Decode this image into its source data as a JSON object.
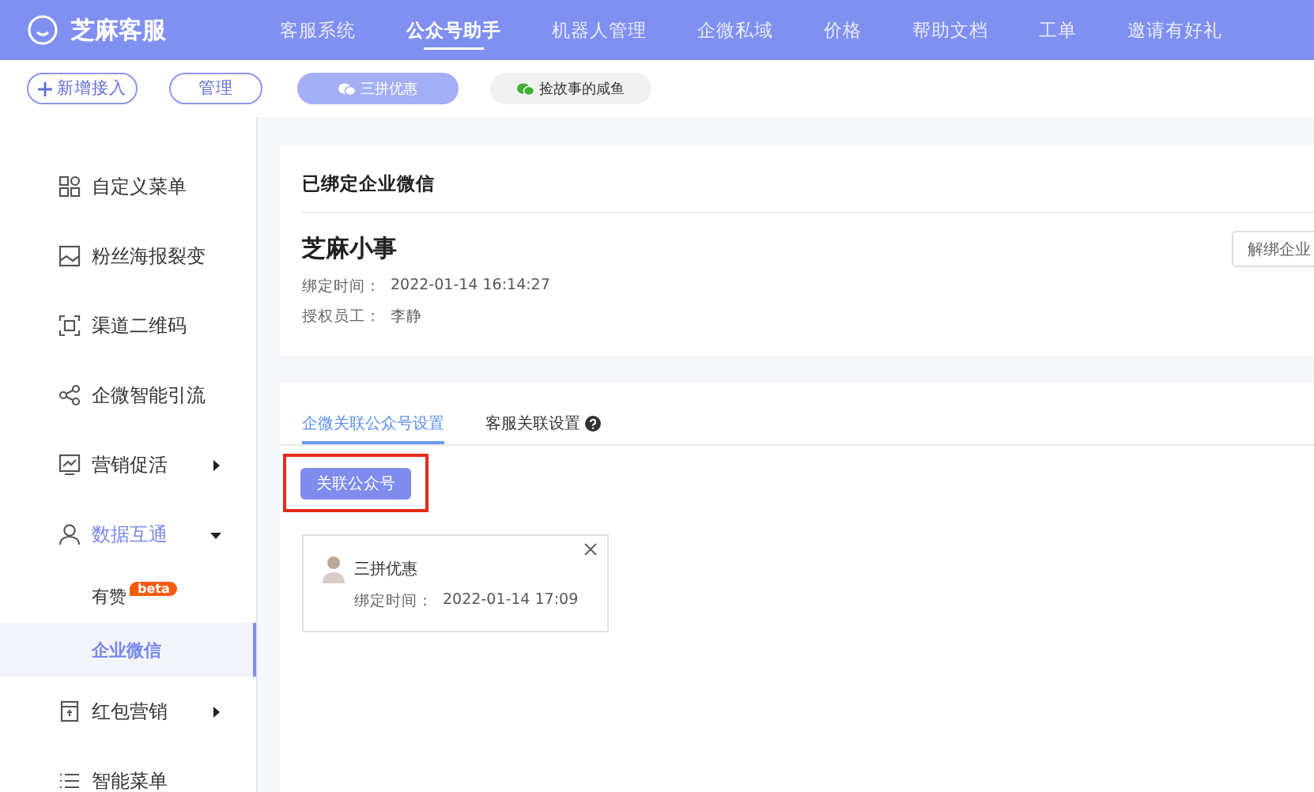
{
  "brand": "芝麻客服",
  "nav": [
    {
      "label": "客服系统",
      "selected": false
    },
    {
      "label": "公众号助手",
      "selected": true
    },
    {
      "label": "机器人管理",
      "selected": false
    },
    {
      "label": "企微私域",
      "selected": false
    },
    {
      "label": "价格",
      "selected": false
    },
    {
      "label": "帮助文档",
      "selected": false
    },
    {
      "label": "工单",
      "selected": false
    },
    {
      "label": "邀请有好礼",
      "selected": false
    }
  ],
  "toolbar": {
    "add_button": "新增接入",
    "manage_button": "管理",
    "accounts": [
      {
        "label": "三拼优惠",
        "selected": true
      },
      {
        "label": "捡故事的咸鱼",
        "selected": false
      }
    ]
  },
  "sidebar": [
    {
      "label": "自定义菜单",
      "kind": "grid",
      "selected": false
    },
    {
      "label": "粉丝海报裂变",
      "kind": "image",
      "selected": false
    },
    {
      "label": "渠道二维码",
      "kind": "scan",
      "selected": false
    },
    {
      "label": "企微智能引流",
      "kind": "share",
      "selected": false
    },
    {
      "label": "营销促活",
      "kind": "chart",
      "selected": false,
      "expanded": false
    },
    {
      "label": "数据互通",
      "kind": "user",
      "selected": true,
      "expanded": true,
      "children": [
        {
          "label": "有赞",
          "badge": "beta",
          "selected": false
        },
        {
          "label": "企业微信",
          "selected": true
        }
      ]
    },
    {
      "label": "红包营销",
      "kind": "packet",
      "selected": false,
      "expanded": false
    },
    {
      "label": "智能菜单",
      "kind": "list",
      "selected": false
    }
  ],
  "bound_card": {
    "title": "已绑定企业微信",
    "name": "芝麻小事",
    "unbind_button": "解绑企业",
    "fields": [
      {
        "label": "绑定时间：",
        "value": "2022-01-14 16:14:27"
      },
      {
        "label": "授权员工：",
        "value": "李静"
      }
    ]
  },
  "settings": {
    "tabs": [
      {
        "label": "企微关联公众号设置",
        "selected": true,
        "help": false
      },
      {
        "label": "客服关联设置",
        "selected": false,
        "help": true
      }
    ],
    "link_button": "关联公众号",
    "accounts": [
      {
        "name": "三拼优惠",
        "field_label": "绑定时间：",
        "field_value": "2022-01-14 17:09"
      }
    ]
  }
}
